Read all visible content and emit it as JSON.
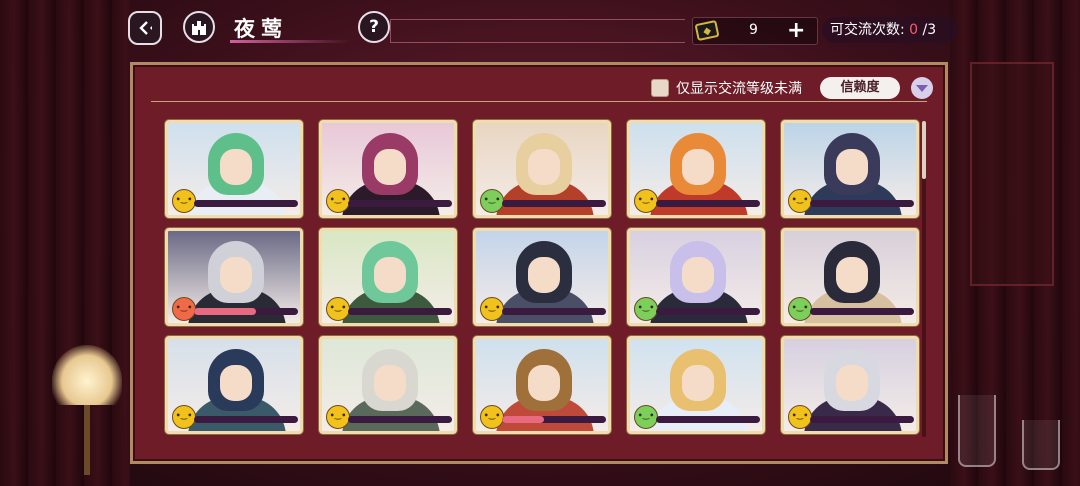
{
  "header": {
    "title": "夜莺",
    "back_icon": "back-arrow-icon",
    "home_icon": "castle-icon",
    "help_label": "?"
  },
  "currency": {
    "icon": "ticket-icon",
    "value": "9",
    "plus_label": "+"
  },
  "exchange": {
    "label": "可交流次数:",
    "current": "0",
    "total": "/3"
  },
  "filter": {
    "label": "仅显示交流等级未满",
    "checked": false
  },
  "sort": {
    "label": "信赖度",
    "arrow_icon": "chevron-down-icon"
  },
  "colors": {
    "mood_yellow": "#f2c21c",
    "mood_green": "#7ccf5a",
    "mood_red": "#f06a48",
    "bar_fill": "#e76a80",
    "panel": "#6e1c28"
  },
  "cards": [
    {
      "mood": "yellow",
      "progress": 0.0
    },
    {
      "mood": "yellow",
      "progress": 0.0
    },
    {
      "mood": "green",
      "progress": 0.0
    },
    {
      "mood": "yellow",
      "progress": 0.0
    },
    {
      "mood": "yellow",
      "progress": 0.0
    },
    {
      "mood": "red",
      "progress": 0.6
    },
    {
      "mood": "yellow",
      "progress": 0.0
    },
    {
      "mood": "yellow",
      "progress": 0.0
    },
    {
      "mood": "green",
      "progress": 0.0
    },
    {
      "mood": "green",
      "progress": 0.0
    },
    {
      "mood": "yellow",
      "progress": 0.0
    },
    {
      "mood": "yellow",
      "progress": 0.0
    },
    {
      "mood": "yellow",
      "progress": 0.4
    },
    {
      "mood": "green",
      "progress": 0.0
    },
    {
      "mood": "yellow",
      "progress": 0.0
    }
  ]
}
